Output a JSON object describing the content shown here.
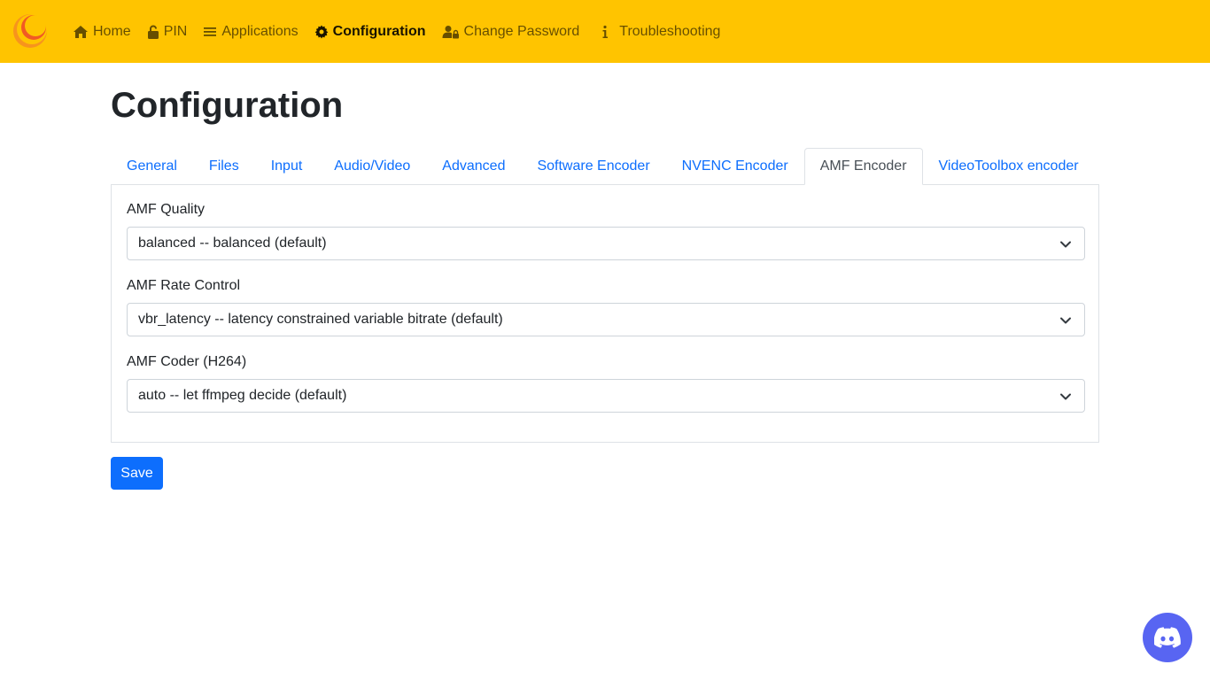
{
  "nav": {
    "home": "Home",
    "pin": "PIN",
    "applications": "Applications",
    "configuration": "Configuration",
    "change_password": "Change Password",
    "troubleshooting": "Troubleshooting"
  },
  "page": {
    "title": "Configuration"
  },
  "tabs": [
    {
      "label": "General"
    },
    {
      "label": "Files"
    },
    {
      "label": "Input"
    },
    {
      "label": "Audio/Video"
    },
    {
      "label": "Advanced"
    },
    {
      "label": "Software Encoder"
    },
    {
      "label": "NVENC Encoder"
    },
    {
      "label": "AMF Encoder"
    },
    {
      "label": "VideoToolbox encoder"
    }
  ],
  "active_tab": "AMF Encoder",
  "fields": {
    "quality": {
      "label": "AMF Quality",
      "value": "balanced -- balanced (default)"
    },
    "rate_control": {
      "label": "AMF Rate Control",
      "value": "vbr_latency -- latency constrained variable bitrate (default)"
    },
    "coder": {
      "label": "AMF Coder (H264)",
      "value": "auto -- let ffmpeg decide (default)"
    }
  },
  "actions": {
    "save_label": "Save"
  },
  "colors": {
    "navbar": "#ffc400",
    "link": "#0d6efd",
    "primary_button": "#0d6efd",
    "discord": "#5865f2"
  },
  "icons": {
    "logo": "sunshine-logo",
    "home": "home-icon",
    "pin": "unlock-icon",
    "applications": "list-icon",
    "configuration": "gear-icon",
    "change_password": "user-lock-icon",
    "troubleshooting": "info-icon",
    "discord": "discord-icon"
  }
}
